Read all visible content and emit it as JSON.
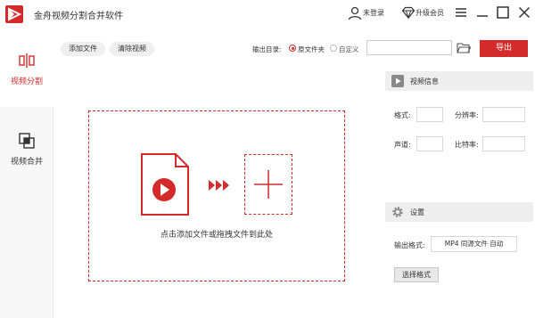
{
  "app": {
    "title": "金舟视频分割合并软件",
    "accent_color": "#d42a2a"
  },
  "titlebar": {
    "user_icon": "user-icon",
    "user_label": "未登录",
    "vip_icon": "diamond-icon",
    "vip_label": "升级会员",
    "menu_icon": "hamburger-menu-icon",
    "minimize_icon": "minimize-icon",
    "maximize_icon": "maximize-icon",
    "close_icon": "close-icon"
  },
  "sidebar": {
    "items": [
      {
        "label": "视频分割",
        "icon": "split-icon",
        "active": true
      },
      {
        "label": "视频合并",
        "icon": "merge-icon",
        "active": false
      }
    ]
  },
  "toolbar": {
    "add_file_label": "添加文件",
    "clear_label": "清除视频",
    "output_dir_label": "输出目录:",
    "option_source": "原文件夹",
    "option_custom": "自定义",
    "selected_option": "原文件夹",
    "path_value": "",
    "folder_icon": "folder-icon",
    "export_label": "导出"
  },
  "main": {
    "drop_hint": "点击添加文件或拖拽文件到此处",
    "file_icon": "video-file-icon",
    "arrows_icon": "triple-arrow-icon",
    "add_icon": "plus-icon"
  },
  "right_panel": {
    "info_title": "视频信息",
    "info_icon": "play-icon",
    "format_label": "格式:",
    "resolution_label": "分辨率:",
    "channel_label": "声道:",
    "bitrate_label": "比特率:",
    "settings_title": "设置",
    "settings_icon": "gear-icon",
    "output_format_label": "输出格式:",
    "output_format_value": "MP4 同源文件 自动",
    "choose_format_label": "选择格式"
  }
}
